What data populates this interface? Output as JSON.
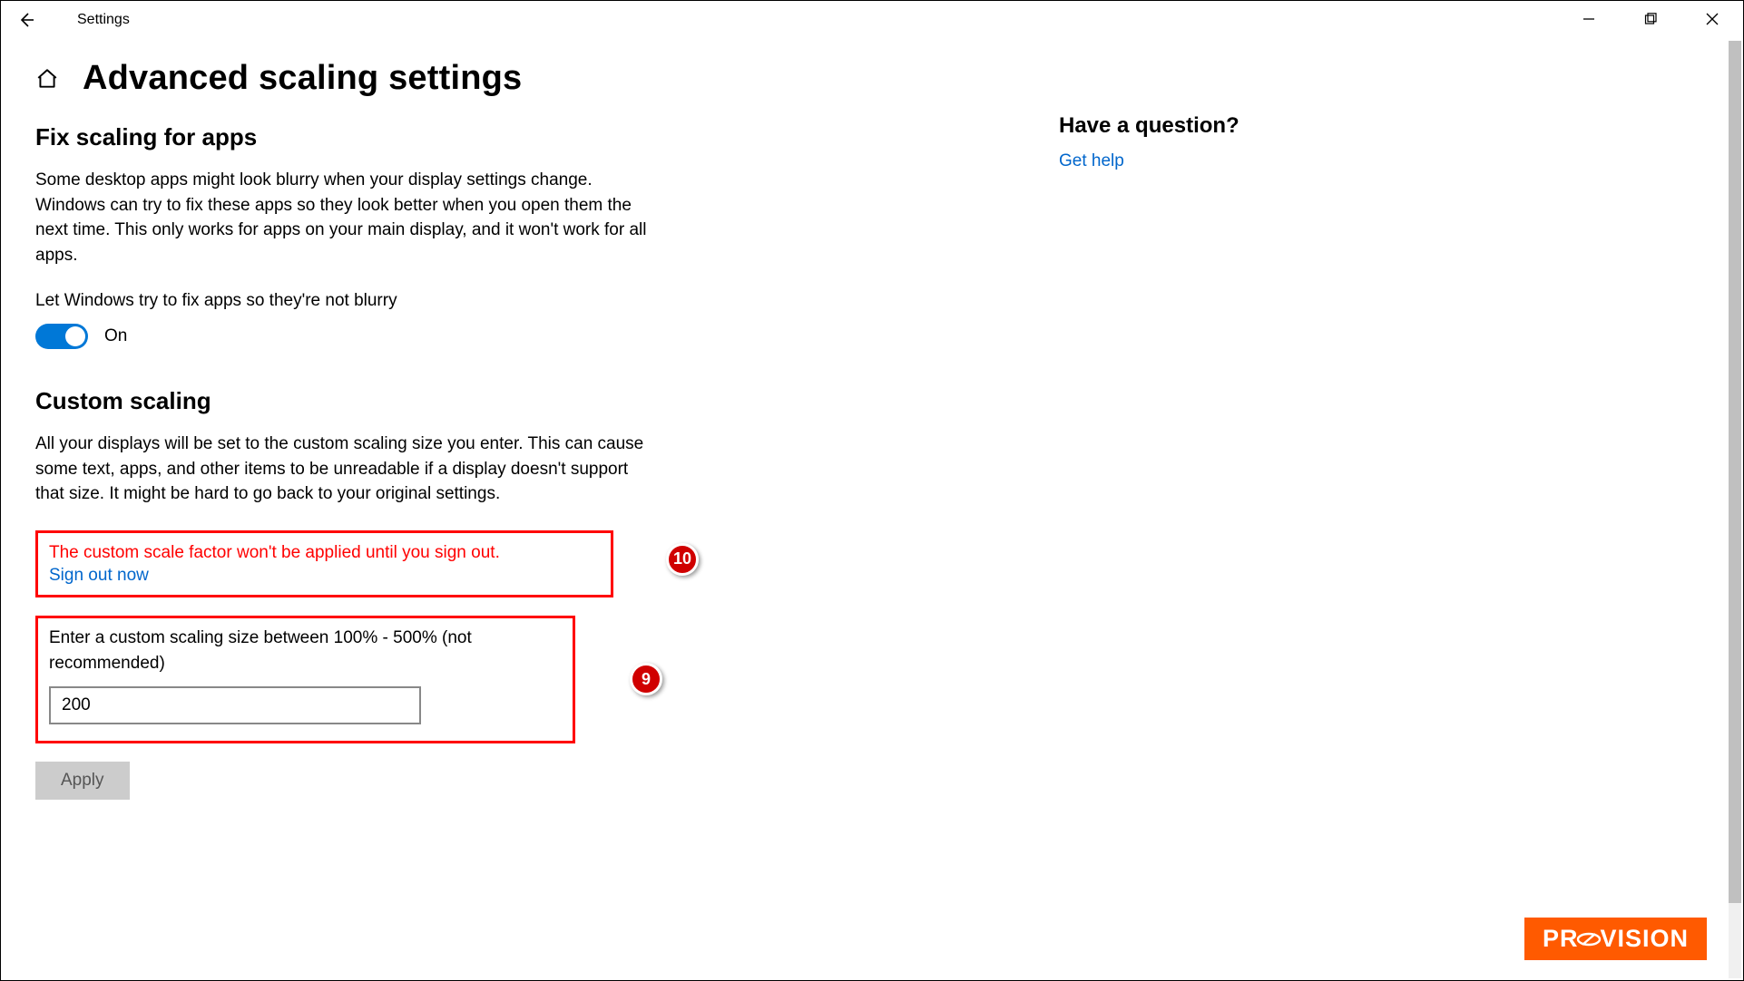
{
  "titlebar": {
    "app_title": "Settings"
  },
  "page": {
    "title": "Advanced scaling settings"
  },
  "fix_scaling": {
    "heading": "Fix scaling for apps",
    "description": "Some desktop apps might look blurry when your display settings change. Windows can try to fix these apps so they look better when you open them the next time. This only works for apps on your main display, and it won't work for all apps.",
    "toggle_label": "Let Windows try to fix apps so they're not blurry",
    "toggle_state": "On"
  },
  "custom_scaling": {
    "heading": "Custom scaling",
    "description": "All your displays will be set to the custom scaling size you enter. This can cause some text, apps, and other items to be unreadable if a display doesn't support that size. It might be hard to go back to your original settings.",
    "warning": "The custom scale factor won't be applied until you sign out.",
    "signout_link": "Sign out now",
    "input_label": "Enter a custom scaling size between 100% - 500% (not recommended)",
    "input_value": "200",
    "apply_label": "Apply"
  },
  "sidebar": {
    "question": "Have a question?",
    "get_help": "Get help"
  },
  "annotations": {
    "badge9": "9",
    "badge10": "10"
  },
  "logo": {
    "text_pr": "PR",
    "text_vision": "VISION"
  }
}
